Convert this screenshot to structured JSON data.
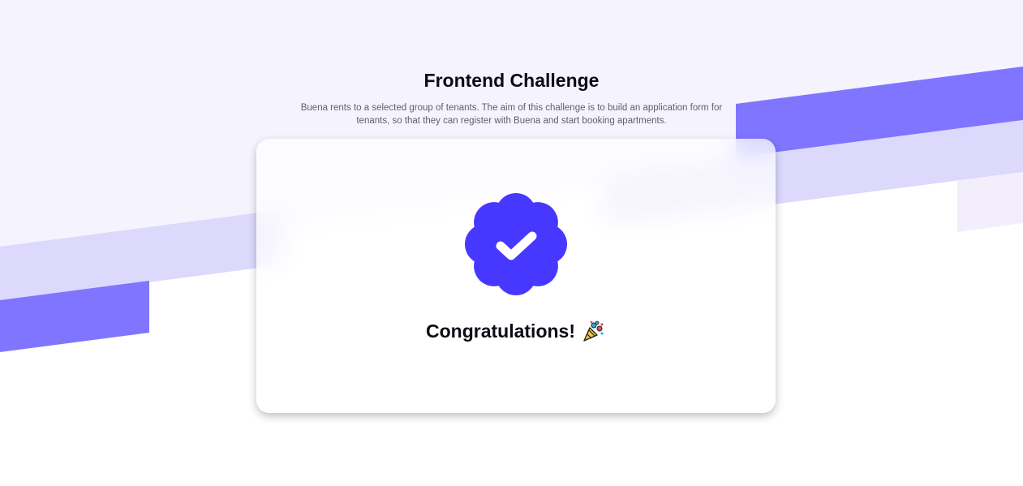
{
  "header": {
    "title": "Frontend Challenge",
    "subtitle": "Buena rents to a selected group of tenants. The aim of this challenge is to build an application form for tenants, so that they can register with Buena and start booking apartments."
  },
  "card": {
    "badge_icon": "verified-check-badge-icon",
    "message": "Congratulations!",
    "message_icon": "party-popper-icon"
  },
  "colors": {
    "accent": "#4738ff",
    "stripe_dark": "#7f75ff",
    "stripe_light": "#dcd9fc",
    "background_tint": "#f5f4fe"
  }
}
